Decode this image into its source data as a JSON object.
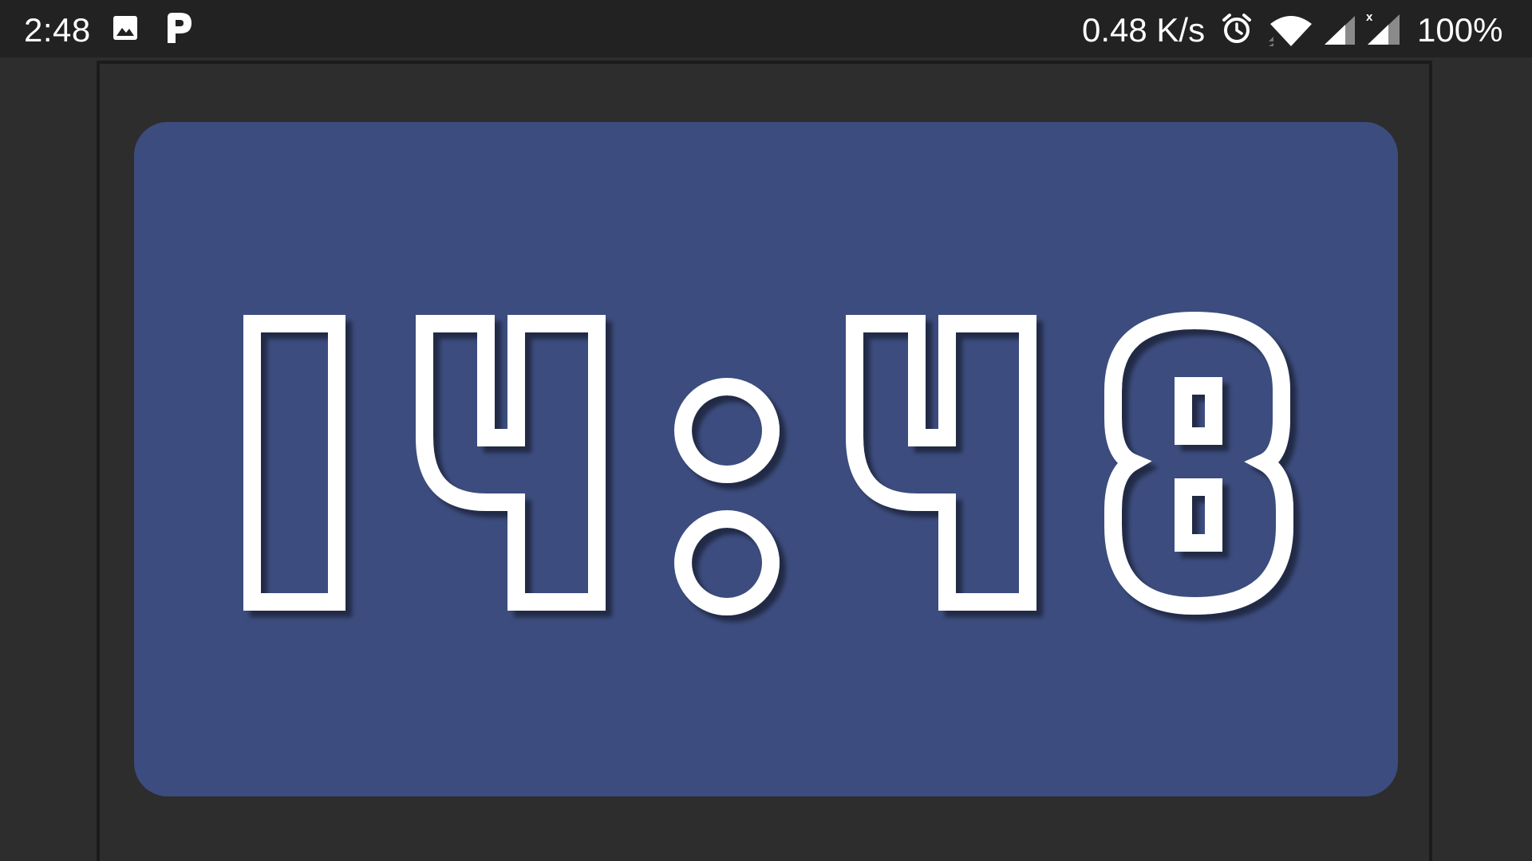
{
  "status_bar": {
    "time": "2:48",
    "network_speed": "0.48 K/s",
    "battery": "100%",
    "left_icons": [
      "image-icon",
      "p-icon"
    ],
    "right_icons": [
      "alarm-icon",
      "wifi-icon",
      "signal-icon",
      "signal-x-icon"
    ]
  },
  "clock": {
    "display": "14:48",
    "digits": [
      "1",
      "4",
      "8"
    ],
    "hours": "14",
    "minutes": "48"
  },
  "colors": {
    "status_bar_bg": "#222222",
    "background": "#2d2d2d",
    "panel": "#3c4c7e",
    "digit_stroke": "#ffffff"
  }
}
